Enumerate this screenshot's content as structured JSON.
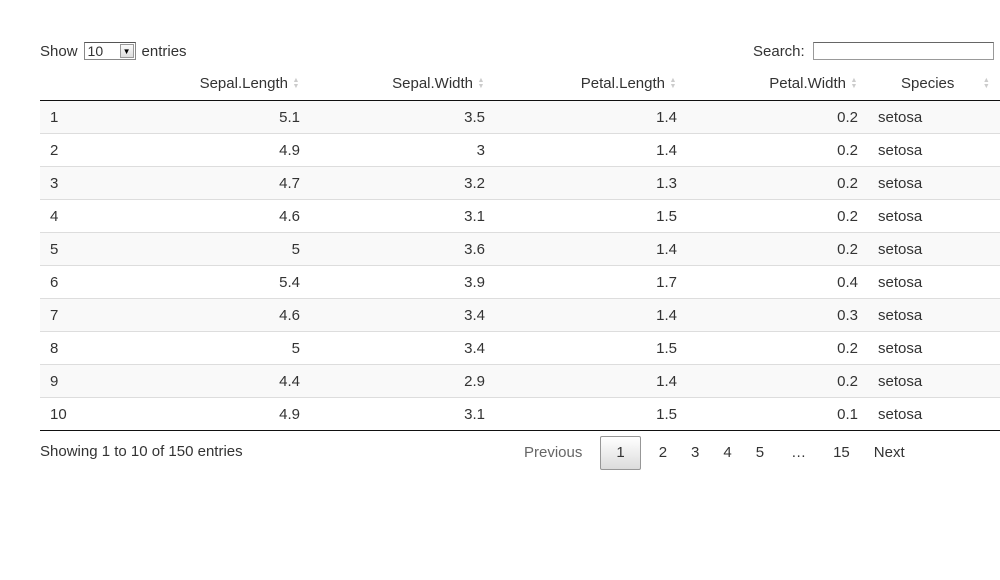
{
  "length_control": {
    "show_label": "Show",
    "selected": "10",
    "entries_label": "entries"
  },
  "search": {
    "label": "Search:",
    "value": ""
  },
  "table": {
    "columns": [
      "",
      "Sepal.Length",
      "Sepal.Width",
      "Petal.Length",
      "Petal.Width",
      "Species"
    ],
    "rows": [
      [
        "1",
        "5.1",
        "3.5",
        "1.4",
        "0.2",
        "setosa"
      ],
      [
        "2",
        "4.9",
        "3",
        "1.4",
        "0.2",
        "setosa"
      ],
      [
        "3",
        "4.7",
        "3.2",
        "1.3",
        "0.2",
        "setosa"
      ],
      [
        "4",
        "4.6",
        "3.1",
        "1.5",
        "0.2",
        "setosa"
      ],
      [
        "5",
        "5",
        "3.6",
        "1.4",
        "0.2",
        "setosa"
      ],
      [
        "6",
        "5.4",
        "3.9",
        "1.7",
        "0.4",
        "setosa"
      ],
      [
        "7",
        "4.6",
        "3.4",
        "1.4",
        "0.3",
        "setosa"
      ],
      [
        "8",
        "5",
        "3.4",
        "1.5",
        "0.2",
        "setosa"
      ],
      [
        "9",
        "4.4",
        "2.9",
        "1.4",
        "0.2",
        "setosa"
      ],
      [
        "10",
        "4.9",
        "3.1",
        "1.5",
        "0.1",
        "setosa"
      ]
    ]
  },
  "info": "Showing 1 to 10 of 150 entries",
  "pagination": {
    "previous": "Previous",
    "pages": [
      "1",
      "2",
      "3",
      "4",
      "5",
      "…",
      "15"
    ],
    "current": "1",
    "next": "Next"
  }
}
